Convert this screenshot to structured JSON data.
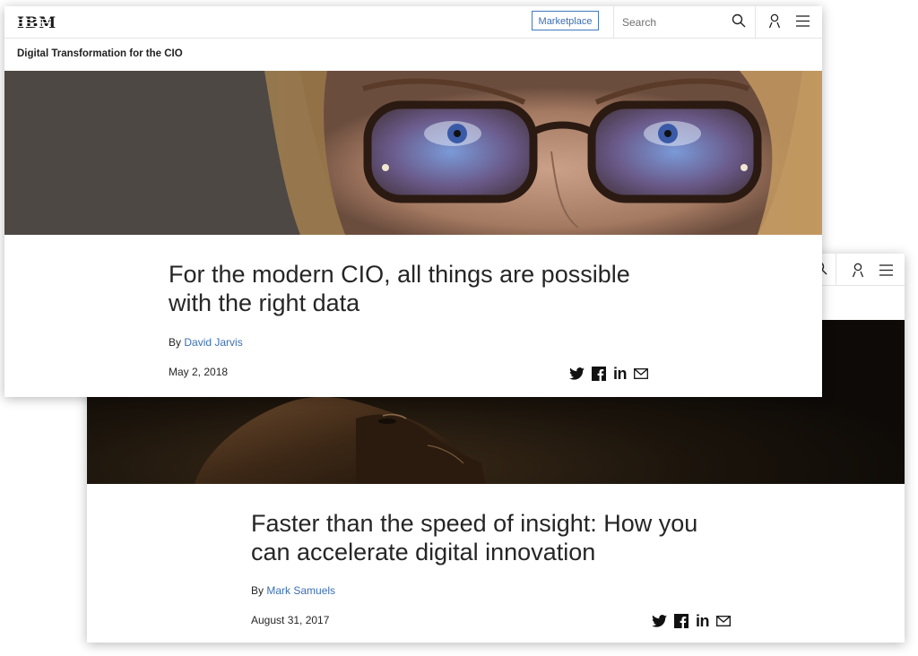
{
  "back_card": {
    "title": "Faster than the speed of insight: How you can accelerate digital innovation",
    "title_line1": "Faster than the speed of insight: How you",
    "title_line2": "can accelerate digital innovation",
    "by_prefix": "By",
    "author": "Mark Samuels",
    "date": "August 31, 2017"
  },
  "front_card": {
    "nav": {
      "logo": "IBM",
      "marketplace_label": "Marketplace",
      "search_placeholder": "Search"
    },
    "section_title": "Digital Transformation for the CIO",
    "title_line1": "For the modern CIO, all things are possible",
    "title_line2": "with the right data",
    "by_prefix": "By",
    "author": "David Jarvis",
    "date": "May 2, 2018"
  },
  "share_icons": [
    "twitter-icon",
    "facebook-icon",
    "linkedin-icon",
    "email-icon"
  ],
  "colors": {
    "link": "#3b6fb5",
    "border": "#4178be",
    "text": "#161616"
  }
}
